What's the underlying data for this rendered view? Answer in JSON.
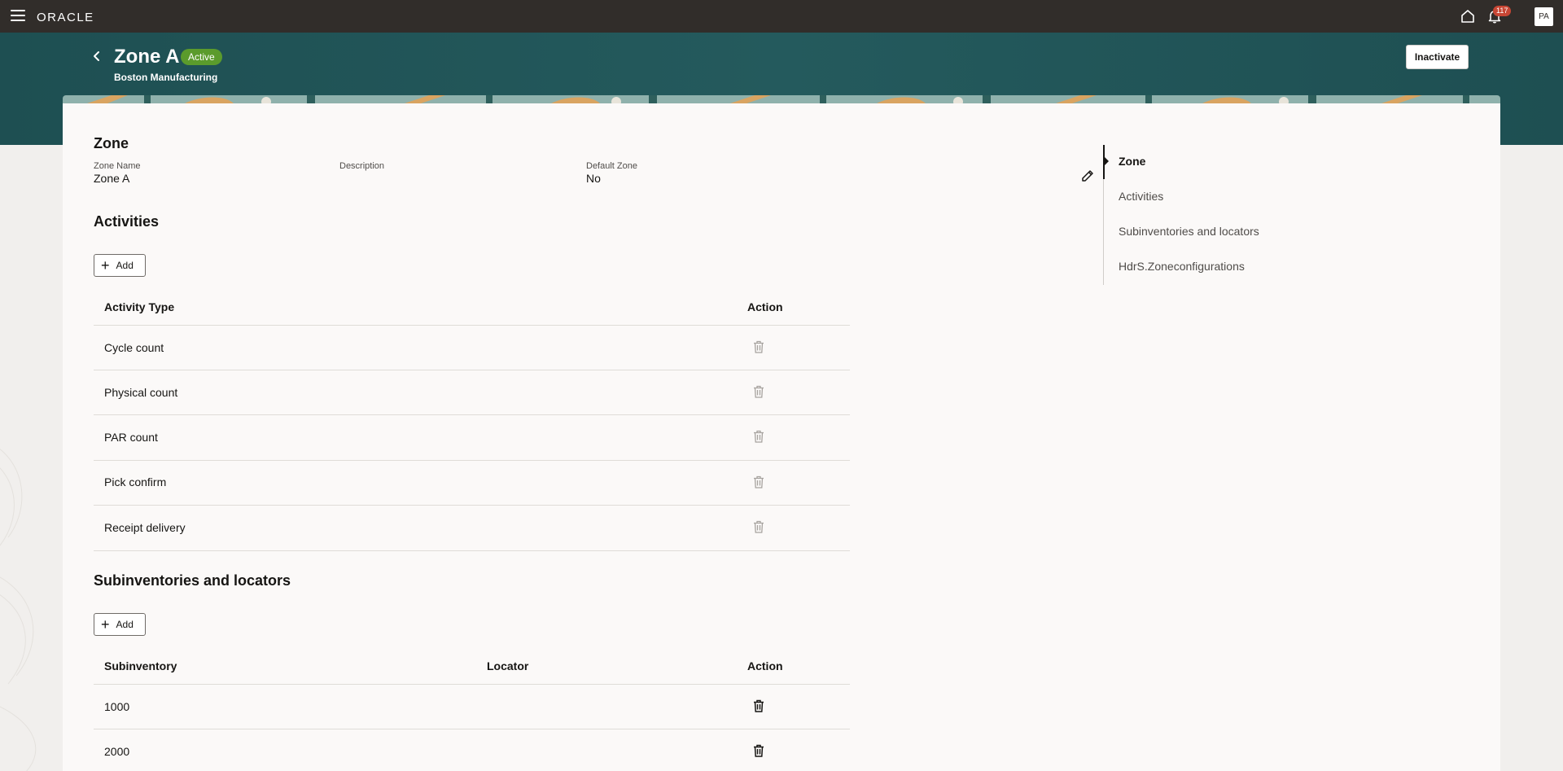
{
  "topbar": {
    "logo": "ORACLE",
    "notifications_count": "117",
    "avatar_initials": "PA"
  },
  "header": {
    "title": "Zone A",
    "status": "Active",
    "subtitle": "Boston Manufacturing",
    "inactivate_label": "Inactivate"
  },
  "zone": {
    "section_title": "Zone",
    "fields": [
      {
        "label": "Zone Name",
        "value": "Zone A"
      },
      {
        "label": "Description",
        "value": ""
      },
      {
        "label": "Default Zone",
        "value": "No"
      }
    ]
  },
  "activities": {
    "section_title": "Activities",
    "add_label": "Add",
    "columns": [
      "Activity Type",
      "Action"
    ],
    "rows": [
      "Cycle count",
      "Physical count",
      "PAR count",
      "Pick confirm",
      "Receipt delivery"
    ]
  },
  "subinventories": {
    "section_title": "Subinventories and locators",
    "add_label": "Add",
    "columns": [
      "Subinventory",
      "Locator",
      "Action"
    ],
    "rows": [
      {
        "subinventory": "1000",
        "locator": ""
      },
      {
        "subinventory": "2000",
        "locator": ""
      }
    ]
  },
  "right_nav": {
    "items": [
      "Zone",
      "Activities",
      "Subinventories and locators",
      "HdrS.Zoneconfigurations"
    ],
    "active": "Zone"
  },
  "colors": {
    "topbar": "#312d2a",
    "header": "#1f5255",
    "status_green": "#5b9b2c",
    "badge_red": "#c74634"
  }
}
